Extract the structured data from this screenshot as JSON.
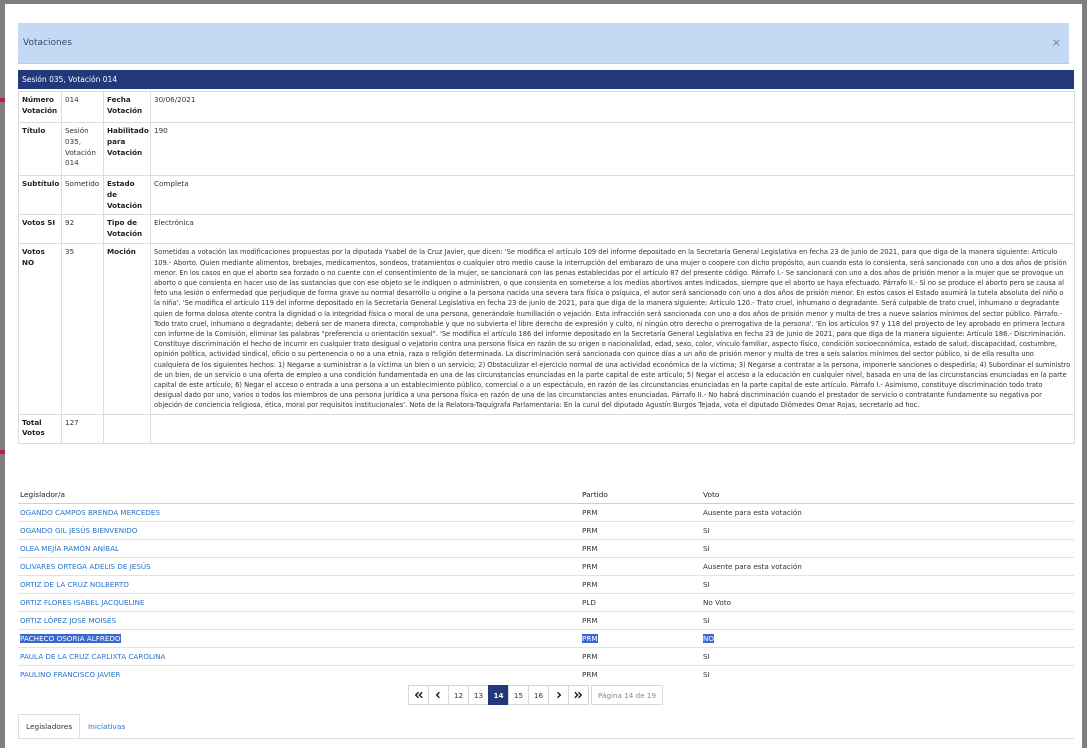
{
  "modal": {
    "title": "Votaciones",
    "close_symbol": "×"
  },
  "section": {
    "heading": "Sesión 035, Votación 014"
  },
  "info": {
    "numero_label": "Número Votación",
    "numero_value": "014",
    "fecha_label": "Fecha Votación",
    "fecha_value": "30/06/2021",
    "titulo_label": "Título",
    "titulo_value": "Sesión 035, Votación 014",
    "habilitado_label": "Habilitado para Votación",
    "habilitado_value": "190",
    "subtitulo_label": "Subtítulo",
    "subtitulo_value": "Sometido",
    "estado_label": "Estado de Votación",
    "estado_value": "Completa",
    "votos_si_label": "Votos SI",
    "votos_si_value": "92",
    "tipo_label": "Tipo de Votación",
    "tipo_value": "Electrónica",
    "votos_no_label": "Votos NO",
    "votos_no_value": "35",
    "mocion_label": "Moción",
    "mocion_value": "Sometidas a votación las modificaciones propuestas por la diputada Ysabel de la Cruz Javier, que dicen: 'Se modifica el artículo 109 del informe depositado en la Secretaría General Legislativa en fecha 23 de junio de 2021, para que diga de la manera siguiente: Artículo 109.- Aborto. Quien mediante alimentos, brebajes, medicamentos, sondeos, tratamientos o cualquier otro medio cause la interrupción del embarazo de una mujer o coopere con dicho propósito, aun cuando esta lo consienta, será sancionado con uno a dos años de prisión menor. En los casos en que el aborto sea forzado o no cuente con el consentimiento de la mujer, se sancionará con las penas establecidas por el artículo 87 del presente código. Párrafo I.- Se sancionará con uno a dos años de prisión menor a la mujer que se provoque un aborto o que consienta en hacer uso de las sustancias que con ese objeto se le indiquen o administren, o que consienta en someterse a los medios abortivos antes indicados, siempre que el aborto se haya efectuado. Párrafo II.- Si no se produce el aborto pero se causa al feto una lesión o enfermedad que perjudique de forma grave su normal desarrollo u origine a la persona nacida una severa tara física o psíquica, el autor será sancionado con uno a dos años de prisión menor. En estos casos el Estado asumirá la tutela absoluta del niño o la niña'. 'Se modifica el artículo 119 del informe depositado en la Secretaría General Legislativa en fecha 23 de junio de 2021, para que diga de la manera siguiente: Artículo 120.- Trato cruel, inhumano o degradante. Será culpable de trato cruel, inhumano o degradante quien de forma dolosa atente contra la dignidad o la integridad física o moral de una persona, generándole humillación o vejación. Esta infracción será sancionada con uno a dos años de prisión menor y multa de tres a nueve salarios mínimos del sector público. Párrafo.- Todo trato cruel, inhumano o degradante; deberá ser de manera directa, comprobable y que no subvierta el libre derecho de expresión y culto, ni ningún otro derecho o prerrogativa de la persona'. 'En los artículos 97 y 118 del proyecto de ley aprobado en primera lectura con informe de la Comisión, eliminar las palabras \"preferencia u orientación sexual\". 'Se modifica el artículo 186 del informe depositado en la Secretaría General Legislativa en fecha 23 de junio de 2021, para que diga de la manera siguiente: Artículo 186.- Discriminación. Constituye discriminación el hecho de incurrir en cualquier trato desigual o vejatorio contra una persona física en razón de su origen o nacionalidad, edad, sexo, color, vínculo familiar, aspecto físico, condición socioeconómica, estado de salud, discapacidad, costumbre, opinión política, actividad sindical, oficio o su pertenencia o no a una etnia, raza o religión determinada. La discriminación será sancionada con quince días a un año de prisión menor y multa de tres a seis salarios mínimos del sector público, si de ella resulta uno cualquiera de los siguientes hechos: 1) Negarse a suministrar a la víctima un bien o un servicio; 2) Obstaculizar el ejercicio normal de una actividad económica de la víctima; 3) Negarse a contratar a la persona, imponerle sanciones o despedirla; 4) Subordinar el suministro de un bien, de un servicio o una oferta de empleo a una condición fundamentada en una de las circunstancias enunciadas en la parte capital de este artículo; 5) Negar el acceso a la educación en cualquier nivel, basada en una de las circunstancias enunciadas en la parte capital de este artículo; 6) Negar el acceso o entrada a una persona a un establecimiento público, comercial o a un espectáculo, en razón de las circunstancias enunciadas en la parte capital de este artículo. Párrafo I.- Asimismo, constituye discriminación todo trato desigual dado por uno, varios o todos los miembros de una persona jurídica a una persona física en razón de una de las circunstancias antes enunciadas. Párrafo II.- No habrá discriminación cuando el prestador de servicio o contratante fundamente su negativa por objeción de conciencia religiosa, ética, moral por requisitos institucionales'. Nota de la Relatora-Taquígrafa Parlamentaria: En la curul del diputado Agustín Burgos Tejada, vota el diputado Diómedes Omar Rojas, secretario ad hoc.",
    "total_label": "Total Votos",
    "total_value": "127"
  },
  "votes_table": {
    "headers": {
      "legislador": "Legislador/a",
      "partido": "Partido",
      "voto": "Voto"
    },
    "rows": [
      {
        "name": "OGANDO CAMPOS BRENDA MERCEDES",
        "partido": "PRM",
        "voto": "Ausente para esta votación"
      },
      {
        "name": "OGANDO GIL JESÚS BIENVENIDO",
        "partido": "PRM",
        "voto": "SI"
      },
      {
        "name": "OLEA MEJÍA RAMÓN ANÍBAL",
        "partido": "PRM",
        "voto": "SI"
      },
      {
        "name": "OLIVARES ORTEGA ADELIS DE JESÚS",
        "partido": "PRM",
        "voto": "Ausente para esta votación"
      },
      {
        "name": "ORTIZ DE LA CRUZ NOLBERTO",
        "partido": "PRM",
        "voto": "SI"
      },
      {
        "name": "ORTIZ FLORES ISABEL JACQUELINE",
        "partido": "PLD",
        "voto": "No Voto"
      },
      {
        "name": "ORTIZ LÓPEZ JOSÉ MOISÉS",
        "partido": "PRM",
        "voto": "SI"
      },
      {
        "name": "PACHECO OSORIA ALFREDO",
        "partido": "PRM",
        "voto": "NO"
      },
      {
        "name": "PAULA DE LA CRUZ CARLIXTA CAROLINA",
        "partido": "PRM",
        "voto": "SI"
      },
      {
        "name": "PAULINO FRANCISCO JAVIER",
        "partido": "PRM",
        "voto": "SI"
      }
    ]
  },
  "pagination": {
    "pages": [
      "12",
      "13",
      "14",
      "15",
      "16"
    ],
    "current": "14",
    "page_info": "Página 14 de 19"
  },
  "tabs": {
    "legisladores": "Legisladores",
    "iniciativas": "Iniciativas"
  }
}
